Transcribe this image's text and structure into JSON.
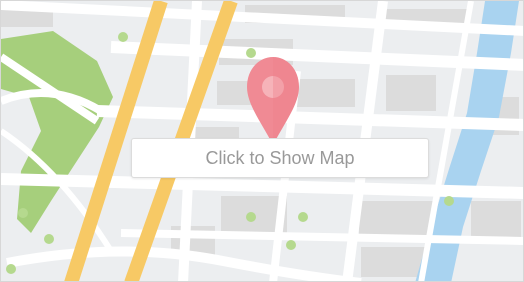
{
  "map": {
    "placeholder_label": "Click to Show Map",
    "pin_icon": "map-pin-icon",
    "colors": {
      "background": "#eceef0",
      "street": "#ffffff",
      "block": "#dcdcdc",
      "park": "#a6cf7c",
      "park_dot": "#b5d98e",
      "highway": "#f7c965",
      "water": "#a9d3f0",
      "pin": "#f08a94",
      "pin_highlight": "#f6b3b9",
      "label_text": "#999999"
    }
  }
}
